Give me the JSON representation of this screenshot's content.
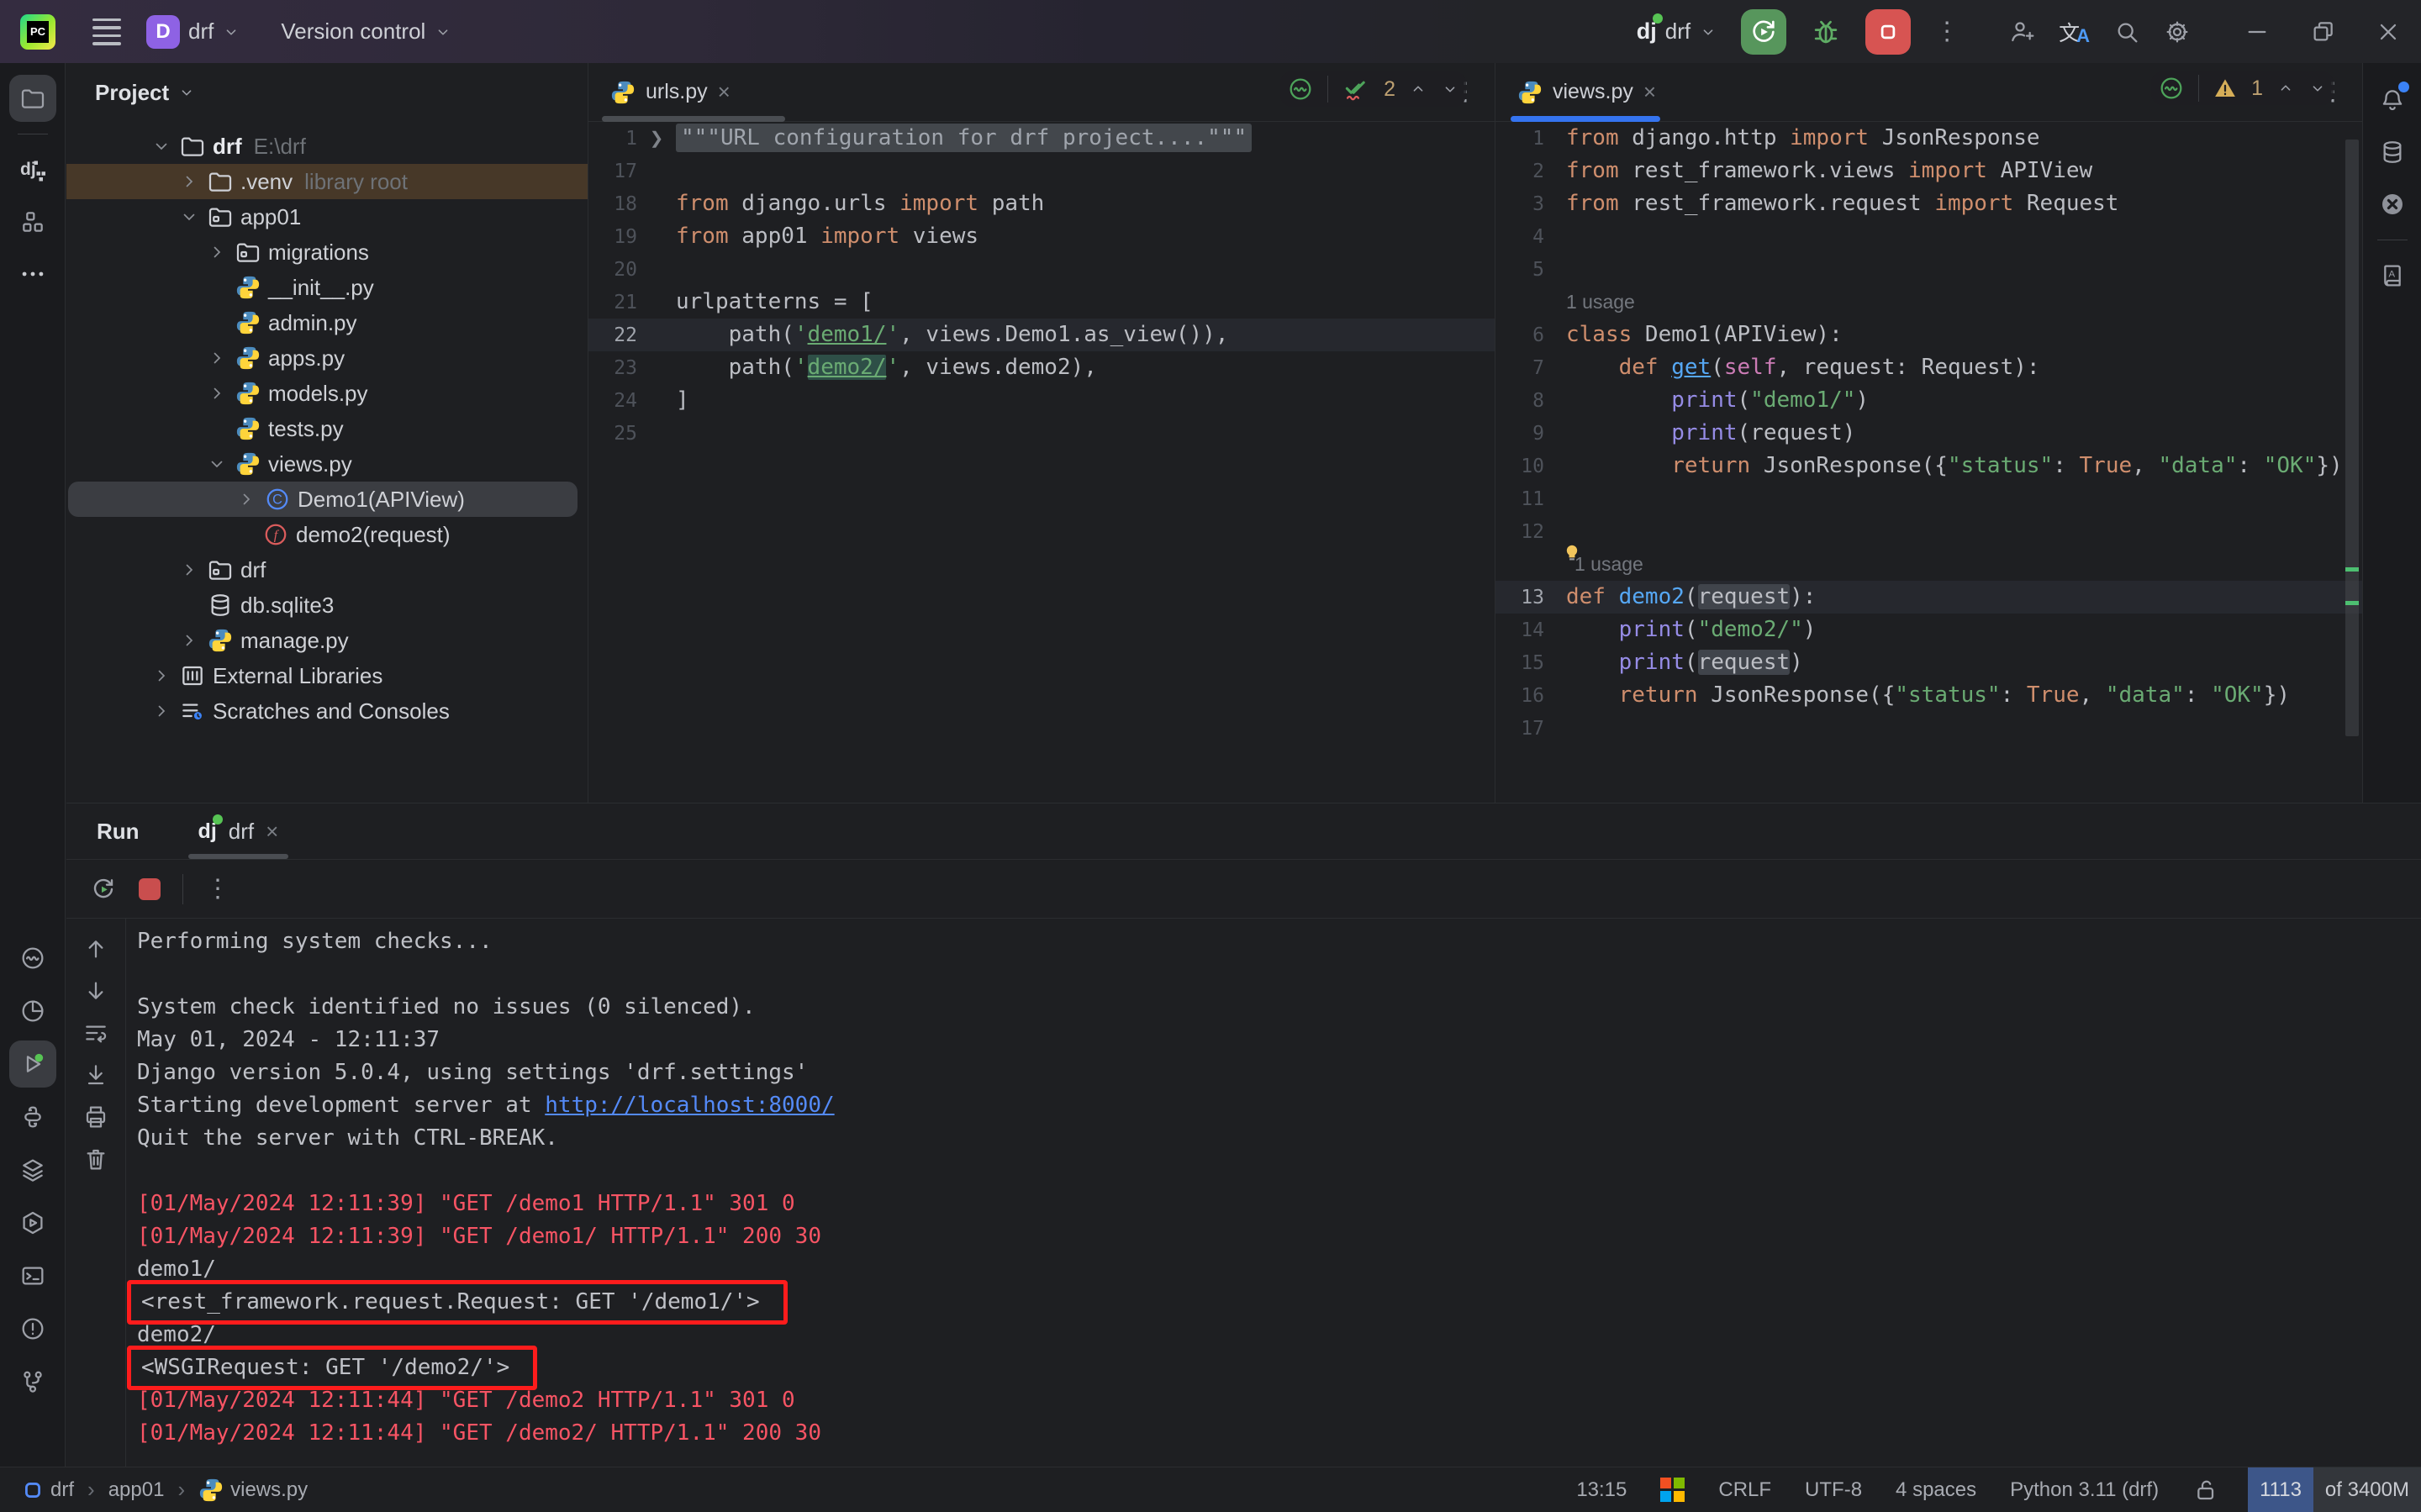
{
  "title_bar": {
    "project_badge": "D",
    "project": "drf",
    "vcs_menu": "Version control",
    "run_config": "drf"
  },
  "tool_stripe_left": {
    "top": [
      {
        "icon": "folder",
        "name": "project-tool-icon",
        "active": true
      },
      {
        "icon": "divider"
      },
      {
        "icon": "django-structure",
        "name": "django-structure-icon"
      },
      {
        "icon": "structure",
        "name": "structure-tool-icon"
      },
      {
        "icon": "more",
        "name": "more-tools-icon"
      }
    ],
    "bottom": [
      {
        "icon": "python-console",
        "name": "python-console-icon"
      },
      {
        "icon": "pie",
        "name": "profiler-icon"
      },
      {
        "icon": "run-play",
        "name": "run-tool-icon",
        "active": true
      },
      {
        "icon": "python-mono",
        "name": "python-packages-icon"
      },
      {
        "icon": "layers",
        "name": "layers-icon"
      },
      {
        "icon": "services",
        "name": "services-icon"
      },
      {
        "icon": "terminal",
        "name": "terminal-icon"
      },
      {
        "icon": "problems",
        "name": "problems-icon"
      },
      {
        "icon": "git-branch",
        "name": "git-branch-icon"
      }
    ]
  },
  "tool_stripe_right": [
    {
      "icon": "bell",
      "name": "notifications-icon",
      "badge": true
    },
    {
      "icon": "database",
      "name": "database-tool-icon"
    },
    {
      "icon": "circle-x",
      "name": "plugin-x-icon"
    },
    {
      "icon": "divider"
    },
    {
      "icon": "book",
      "name": "documentation-icon"
    }
  ],
  "project_panel": {
    "title": "Project",
    "tree": [
      {
        "level": 0,
        "chev": "down",
        "icon": "folder",
        "label": "drf",
        "bold": true,
        "extra": "E:\\drf"
      },
      {
        "level": 1,
        "chev": "right",
        "icon": "folder",
        "label": ".venv",
        "extra": "library root",
        "cls": "row-venv"
      },
      {
        "level": 1,
        "chev": "down",
        "icon": "folder-pkg",
        "label": "app01"
      },
      {
        "level": 2,
        "chev": "right",
        "icon": "folder-pkg",
        "label": "migrations"
      },
      {
        "level": 2,
        "icon": "python",
        "label": "__init__.py"
      },
      {
        "level": 2,
        "icon": "python",
        "label": "admin.py"
      },
      {
        "level": 2,
        "chev": "right",
        "icon": "python",
        "label": "apps.py"
      },
      {
        "level": 2,
        "chev": "right",
        "icon": "python",
        "label": "models.py"
      },
      {
        "level": 2,
        "icon": "python",
        "label": "tests.py"
      },
      {
        "level": 2,
        "chev": "down",
        "icon": "python",
        "label": "views.py"
      },
      {
        "level": 3,
        "chev": "right",
        "icon": "class",
        "label": "Demo1(APIView)",
        "cls": "row-selected"
      },
      {
        "level": 3,
        "icon": "function",
        "label": "demo2(request)"
      },
      {
        "level": 1,
        "chev": "right",
        "icon": "folder-pkg",
        "label": "drf"
      },
      {
        "level": 1,
        "icon": "database",
        "label": "db.sqlite3"
      },
      {
        "level": 1,
        "chev": "right",
        "icon": "python",
        "label": "manage.py"
      },
      {
        "level": 0,
        "chev": "right",
        "icon": "extlib",
        "label": "External Libraries"
      },
      {
        "level": 0,
        "chev": "right",
        "icon": "scratches",
        "label": "Scratches and Consoles"
      }
    ]
  },
  "editors": {
    "urls": {
      "tab_label": "urls.py",
      "widget_count": "2",
      "lines": [
        {
          "n": "1",
          "fold": true,
          "segs": [
            {
              "t": "\"\"\"URL configuration for drf project....\"\"\"",
              "c": "doc"
            }
          ]
        },
        {
          "n": "17"
        },
        {
          "n": "18",
          "segs": [
            {
              "t": "from ",
              "c": "kw"
            },
            {
              "t": "django.urls ",
              "c": "txt"
            },
            {
              "t": "import ",
              "c": "kw"
            },
            {
              "t": "path",
              "c": "txt"
            }
          ]
        },
        {
          "n": "19",
          "segs": [
            {
              "t": "from ",
              "c": "kw"
            },
            {
              "t": "app01 ",
              "c": "txt"
            },
            {
              "t": "import ",
              "c": "kw"
            },
            {
              "t": "views",
              "c": "txt"
            }
          ]
        },
        {
          "n": "20"
        },
        {
          "n": "21",
          "segs": [
            {
              "t": "urlpatterns = [",
              "c": "txt"
            }
          ]
        },
        {
          "n": "22",
          "cur": true,
          "segs": [
            {
              "t": "    path(",
              "c": "txt"
            },
            {
              "t": "'",
              "c": "str"
            },
            {
              "t": "demo1/",
              "c": "str u"
            },
            {
              "t": "'",
              "c": "str"
            },
            {
              "t": ", views.Demo1.as_view()),",
              "c": "txt"
            }
          ]
        },
        {
          "n": "23",
          "segs": [
            {
              "t": "    path(",
              "c": "txt"
            },
            {
              "t": "'",
              "c": "str"
            },
            {
              "t": "demo2/",
              "c": "str u sel"
            },
            {
              "t": "'",
              "c": "str"
            },
            {
              "t": ", views.demo2),",
              "c": "txt"
            }
          ]
        },
        {
          "n": "24",
          "segs": [
            {
              "t": "]",
              "c": "txt"
            }
          ]
        },
        {
          "n": "25"
        }
      ]
    },
    "views": {
      "tab_label": "views.py",
      "widget_count": "1",
      "lines": [
        {
          "n": "1",
          "segs": [
            {
              "t": "from ",
              "c": "kw"
            },
            {
              "t": "django.http ",
              "c": "txt"
            },
            {
              "t": "import ",
              "c": "kw"
            },
            {
              "t": "JsonResponse",
              "c": "txt"
            }
          ]
        },
        {
          "n": "2",
          "segs": [
            {
              "t": "from ",
              "c": "kw"
            },
            {
              "t": "rest_framework.views ",
              "c": "txt"
            },
            {
              "t": "import ",
              "c": "kw"
            },
            {
              "t": "APIView",
              "c": "txt"
            }
          ]
        },
        {
          "n": "3",
          "segs": [
            {
              "t": "from ",
              "c": "kw"
            },
            {
              "t": "rest_framework.request ",
              "c": "txt"
            },
            {
              "t": "import ",
              "c": "kw"
            },
            {
              "t": "Request",
              "c": "txt"
            }
          ]
        },
        {
          "n": "4"
        },
        {
          "n": "5"
        },
        {
          "inlay": "1 usage"
        },
        {
          "n": "6",
          "segs": [
            {
              "t": "class ",
              "c": "kw"
            },
            {
              "t": "Demo1(APIView):",
              "c": "txt"
            }
          ]
        },
        {
          "n": "7",
          "segs": [
            {
              "t": "    ",
              "c": "txt"
            },
            {
              "t": "def ",
              "c": "kw"
            },
            {
              "t": "get",
              "c": "fn u"
            },
            {
              "t": "(",
              "c": "txt"
            },
            {
              "t": "self",
              "c": "self"
            },
            {
              "t": ", request: Request):",
              "c": "txt"
            }
          ]
        },
        {
          "n": "8",
          "segs": [
            {
              "t": "        ",
              "c": "txt"
            },
            {
              "t": "print",
              "c": "bi"
            },
            {
              "t": "(",
              "c": "txt"
            },
            {
              "t": "\"demo1/\"",
              "c": "str"
            },
            {
              "t": ")",
              "c": "txt"
            }
          ]
        },
        {
          "n": "9",
          "segs": [
            {
              "t": "        ",
              "c": "txt"
            },
            {
              "t": "print",
              "c": "bi"
            },
            {
              "t": "(request)",
              "c": "txt"
            }
          ]
        },
        {
          "n": "10",
          "segs": [
            {
              "t": "        ",
              "c": "txt"
            },
            {
              "t": "return ",
              "c": "kw"
            },
            {
              "t": "JsonResponse({",
              "c": "txt"
            },
            {
              "t": "\"status\"",
              "c": "str"
            },
            {
              "t": ": ",
              "c": "txt"
            },
            {
              "t": "True",
              "c": "kw"
            },
            {
              "t": ", ",
              "c": "txt"
            },
            {
              "t": "\"data\"",
              "c": "str"
            },
            {
              "t": ": ",
              "c": "txt"
            },
            {
              "t": "\"OK\"",
              "c": "str"
            },
            {
              "t": "})",
              "c": "txt"
            }
          ]
        },
        {
          "n": "11"
        },
        {
          "n": "12"
        },
        {
          "inlay": "1 usage",
          "bulb": true
        },
        {
          "n": "13",
          "cur": true,
          "segs": [
            {
              "t": "def ",
              "c": "kw"
            },
            {
              "t": "demo2",
              "c": "fn"
            },
            {
              "t": "(",
              "c": "txt"
            },
            {
              "t": "request",
              "c": "txt hl"
            },
            {
              "t": "):",
              "c": "txt"
            }
          ]
        },
        {
          "n": "14",
          "segs": [
            {
              "t": "    ",
              "c": "txt"
            },
            {
              "t": "print",
              "c": "bi"
            },
            {
              "t": "(",
              "c": "txt"
            },
            {
              "t": "\"demo2/\"",
              "c": "str"
            },
            {
              "t": ")",
              "c": "txt"
            }
          ]
        },
        {
          "n": "15",
          "segs": [
            {
              "t": "    ",
              "c": "txt"
            },
            {
              "t": "print",
              "c": "bi"
            },
            {
              "t": "(",
              "c": "txt"
            },
            {
              "t": "request",
              "c": "txt hl"
            },
            {
              "t": ")",
              "c": "txt"
            }
          ]
        },
        {
          "n": "16",
          "segs": [
            {
              "t": "    ",
              "c": "txt"
            },
            {
              "t": "return ",
              "c": "kw"
            },
            {
              "t": "JsonResponse({",
              "c": "txt"
            },
            {
              "t": "\"status\"",
              "c": "str"
            },
            {
              "t": ": ",
              "c": "txt"
            },
            {
              "t": "True",
              "c": "kw"
            },
            {
              "t": ", ",
              "c": "txt"
            },
            {
              "t": "\"data\"",
              "c": "str"
            },
            {
              "t": ": ",
              "c": "txt"
            },
            {
              "t": "\"OK\"",
              "c": "str"
            },
            {
              "t": "})",
              "c": "txt"
            }
          ]
        },
        {
          "n": "17"
        }
      ]
    }
  },
  "run_panel": {
    "title": "Run",
    "tab_label": "drf",
    "console": [
      {
        "segs": [
          {
            "t": "Performing system checks...",
            "c": "plain"
          }
        ]
      },
      {},
      {
        "segs": [
          {
            "t": "System check identified no issues (0 silenced).",
            "c": "plain"
          }
        ]
      },
      {
        "segs": [
          {
            "t": "May 01, 2024 - 12:11:37",
            "c": "plain"
          }
        ]
      },
      {
        "segs": [
          {
            "t": "Django version 5.0.4, using settings 'drf.settings'",
            "c": "plain"
          }
        ]
      },
      {
        "segs": [
          {
            "t": "Starting development server at ",
            "c": "plain"
          },
          {
            "t": "http://localhost:8000/",
            "c": "link",
            "name": "server-url-link"
          }
        ]
      },
      {
        "segs": [
          {
            "t": "Quit the server with CTRL-BREAK.",
            "c": "plain"
          }
        ]
      },
      {},
      {
        "segs": [
          {
            "t": "[01/May/2024 12:11:39] \"GET /demo1 HTTP/1.1\" 301 0",
            "c": "red"
          }
        ]
      },
      {
        "segs": [
          {
            "t": "[01/May/2024 12:11:39] \"GET /demo1/ HTTP/1.1\" 200 30",
            "c": "red"
          }
        ]
      },
      {
        "segs": [
          {
            "t": "demo1/",
            "c": "plain"
          }
        ]
      },
      {
        "box": true,
        "segs": [
          {
            "t": "<rest_framework.request.Request: GET '/demo1/'>",
            "c": "plain"
          }
        ]
      },
      {
        "segs": [
          {
            "t": "demo2/",
            "c": "plain"
          }
        ]
      },
      {
        "box": true,
        "segs": [
          {
            "t": "<WSGIRequest: GET '/demo2/'>",
            "c": "plain"
          }
        ]
      },
      {
        "segs": [
          {
            "t": "[01/May/2024 12:11:44] \"GET /demo2 HTTP/1.1\" 301 0",
            "c": "red"
          }
        ]
      },
      {
        "segs": [
          {
            "t": "[01/May/2024 12:11:44] \"GET /demo2/ HTTP/1.1\" 200 30",
            "c": "red"
          }
        ]
      }
    ]
  },
  "status_bar": {
    "breadcrumbs": [
      {
        "label": "drf",
        "icon": "project"
      },
      {
        "label": "app01"
      },
      {
        "label": "views.py",
        "icon": "python"
      }
    ],
    "right_items": [
      {
        "label": "13:15",
        "name": "cursor-position"
      },
      {
        "icon": "windows",
        "name": "windows-defender-icon"
      },
      {
        "label": "CRLF",
        "name": "line-separator"
      },
      {
        "label": "UTF-8",
        "name": "file-encoding"
      },
      {
        "label": "4 spaces",
        "name": "indent-style"
      },
      {
        "label": "Python 3.11 (drf)",
        "name": "python-interpreter"
      },
      {
        "icon": "unlock",
        "name": "readonly-toggle-icon"
      }
    ],
    "memory_used": "1113",
    "memory_total": "of 3400M"
  }
}
